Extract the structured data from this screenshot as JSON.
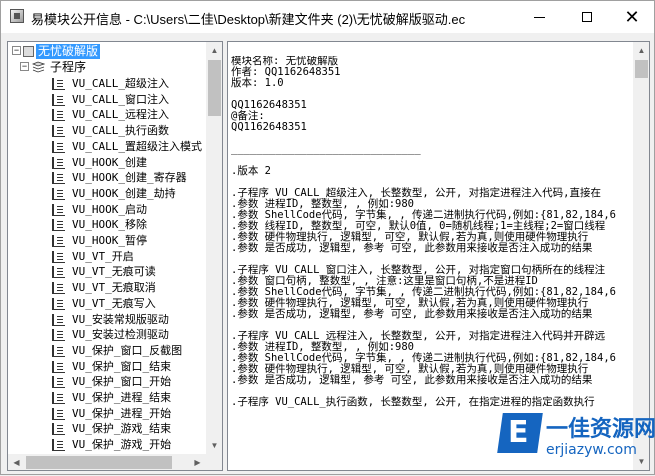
{
  "window": {
    "title": "易模块公开信息 - C:\\Users\\二佳\\Desktop\\新建文件夹 (2)\\无忧破解版驱动.ec",
    "min_glyph": "─",
    "max_glyph": "☐",
    "close_glyph": "✕"
  },
  "tree": {
    "root_label": "无忧破解版",
    "root_expander": "−",
    "child_label": "子程序",
    "child_expander": "−",
    "items": [
      "VU_CALL_超级注入",
      "VU_CALL_窗口注入",
      "VU_CALL_远程注入",
      "VU_CALL_执行函数",
      "VU_CALL_置超级注入模式",
      "VU_HOOK_创建",
      "VU_HOOK_创建_寄存器",
      "VU_HOOK_创建_劫持",
      "VU_HOOK_启动",
      "VU_HOOK_移除",
      "VU_HOOK_暂停",
      "VU_VT_开启",
      "VU_VT_无痕可读",
      "VU_VT_无痕取消",
      "VU_VT_无痕写入",
      "VU_安装常规版驱动",
      "VU_安装过检测驱动",
      "VU_保护_窗口_反截图",
      "VU_保护_窗口_结束",
      "VU_保护_窗口_开始",
      "VU_保护_进程_结束",
      "VU_保护_进程_开始",
      "VU_保护_游戏_结束",
      "VU_保护_游戏_开始"
    ]
  },
  "content": {
    "lines": [
      "模块名称: 无忧破解版",
      "作者: QQ1162648351",
      "版本: 1.0",
      "",
      "QQ1162648351",
      "@备注:",
      "QQ1162648351",
      "",
      "______________________________",
      "",
      ".版本 2",
      "",
      ".子程序 VU_CALL_超级注入, 长整数型, 公开, 对指定进程注入代码,直接在",
      ".参数 进程ID, 整数型, , 例如:980",
      ".参数 ShellCode代码, 字节集, , 传递二进制执行代码,例如:{81,82,184,6",
      ".参数 线程ID, 整数型, 可空, 默认0值, 0=随机线程;1=主线程;2=窗口线程",
      ".参数 硬件物理执行, 逻辑型, 可空, 默认假,若为真,则使用硬件物理执行",
      ".参数 是否成功, 逻辑型, 参考 可空, 此参数用来接收是否注入成功的结果",
      "",
      ".子程序 VU_CALL_窗口注入, 长整数型, 公开, 对指定窗口句柄所在的线程注",
      ".参数 窗口句柄, 整数型, , 注意:这里是窗口句柄,不是进程ID",
      ".参数 ShellCode代码, 字节集, , 传递二进制执行代码,例如:{81,82,184,6",
      ".参数 硬件物理执行, 逻辑型, 可空, 默认假,若为真,则使用硬件物理执行",
      ".参数 是否成功, 逻辑型, 参考 可空, 此参数用来接收是否注入成功的结果",
      "",
      ".子程序 VU_CALL_远程注入, 长整数型, 公开, 对指定进程注入代码并开辟远",
      ".参数 进程ID, 整数型, , 例如:980",
      ".参数 ShellCode代码, 字节集, , 传递二进制执行代码,例如:{81,82,184,6",
      ".参数 硬件物理执行, 逻辑型, 可空, 默认假,若为真,则使用硬件物理执行",
      ".参数 是否成功, 逻辑型, 参考 可空, 此参数用来接收是否注入成功的结果",
      "",
      ".子程序 VU_CALL_执行函数, 长整数型, 公开, 在指定进程的指定函数执行"
    ]
  },
  "watermark": {
    "letter": "E",
    "text": "一佳资源网",
    "url": "erjiazyw.com"
  },
  "scroll": {
    "up": "▲",
    "down": "▼",
    "left": "◀",
    "right": "▶"
  }
}
